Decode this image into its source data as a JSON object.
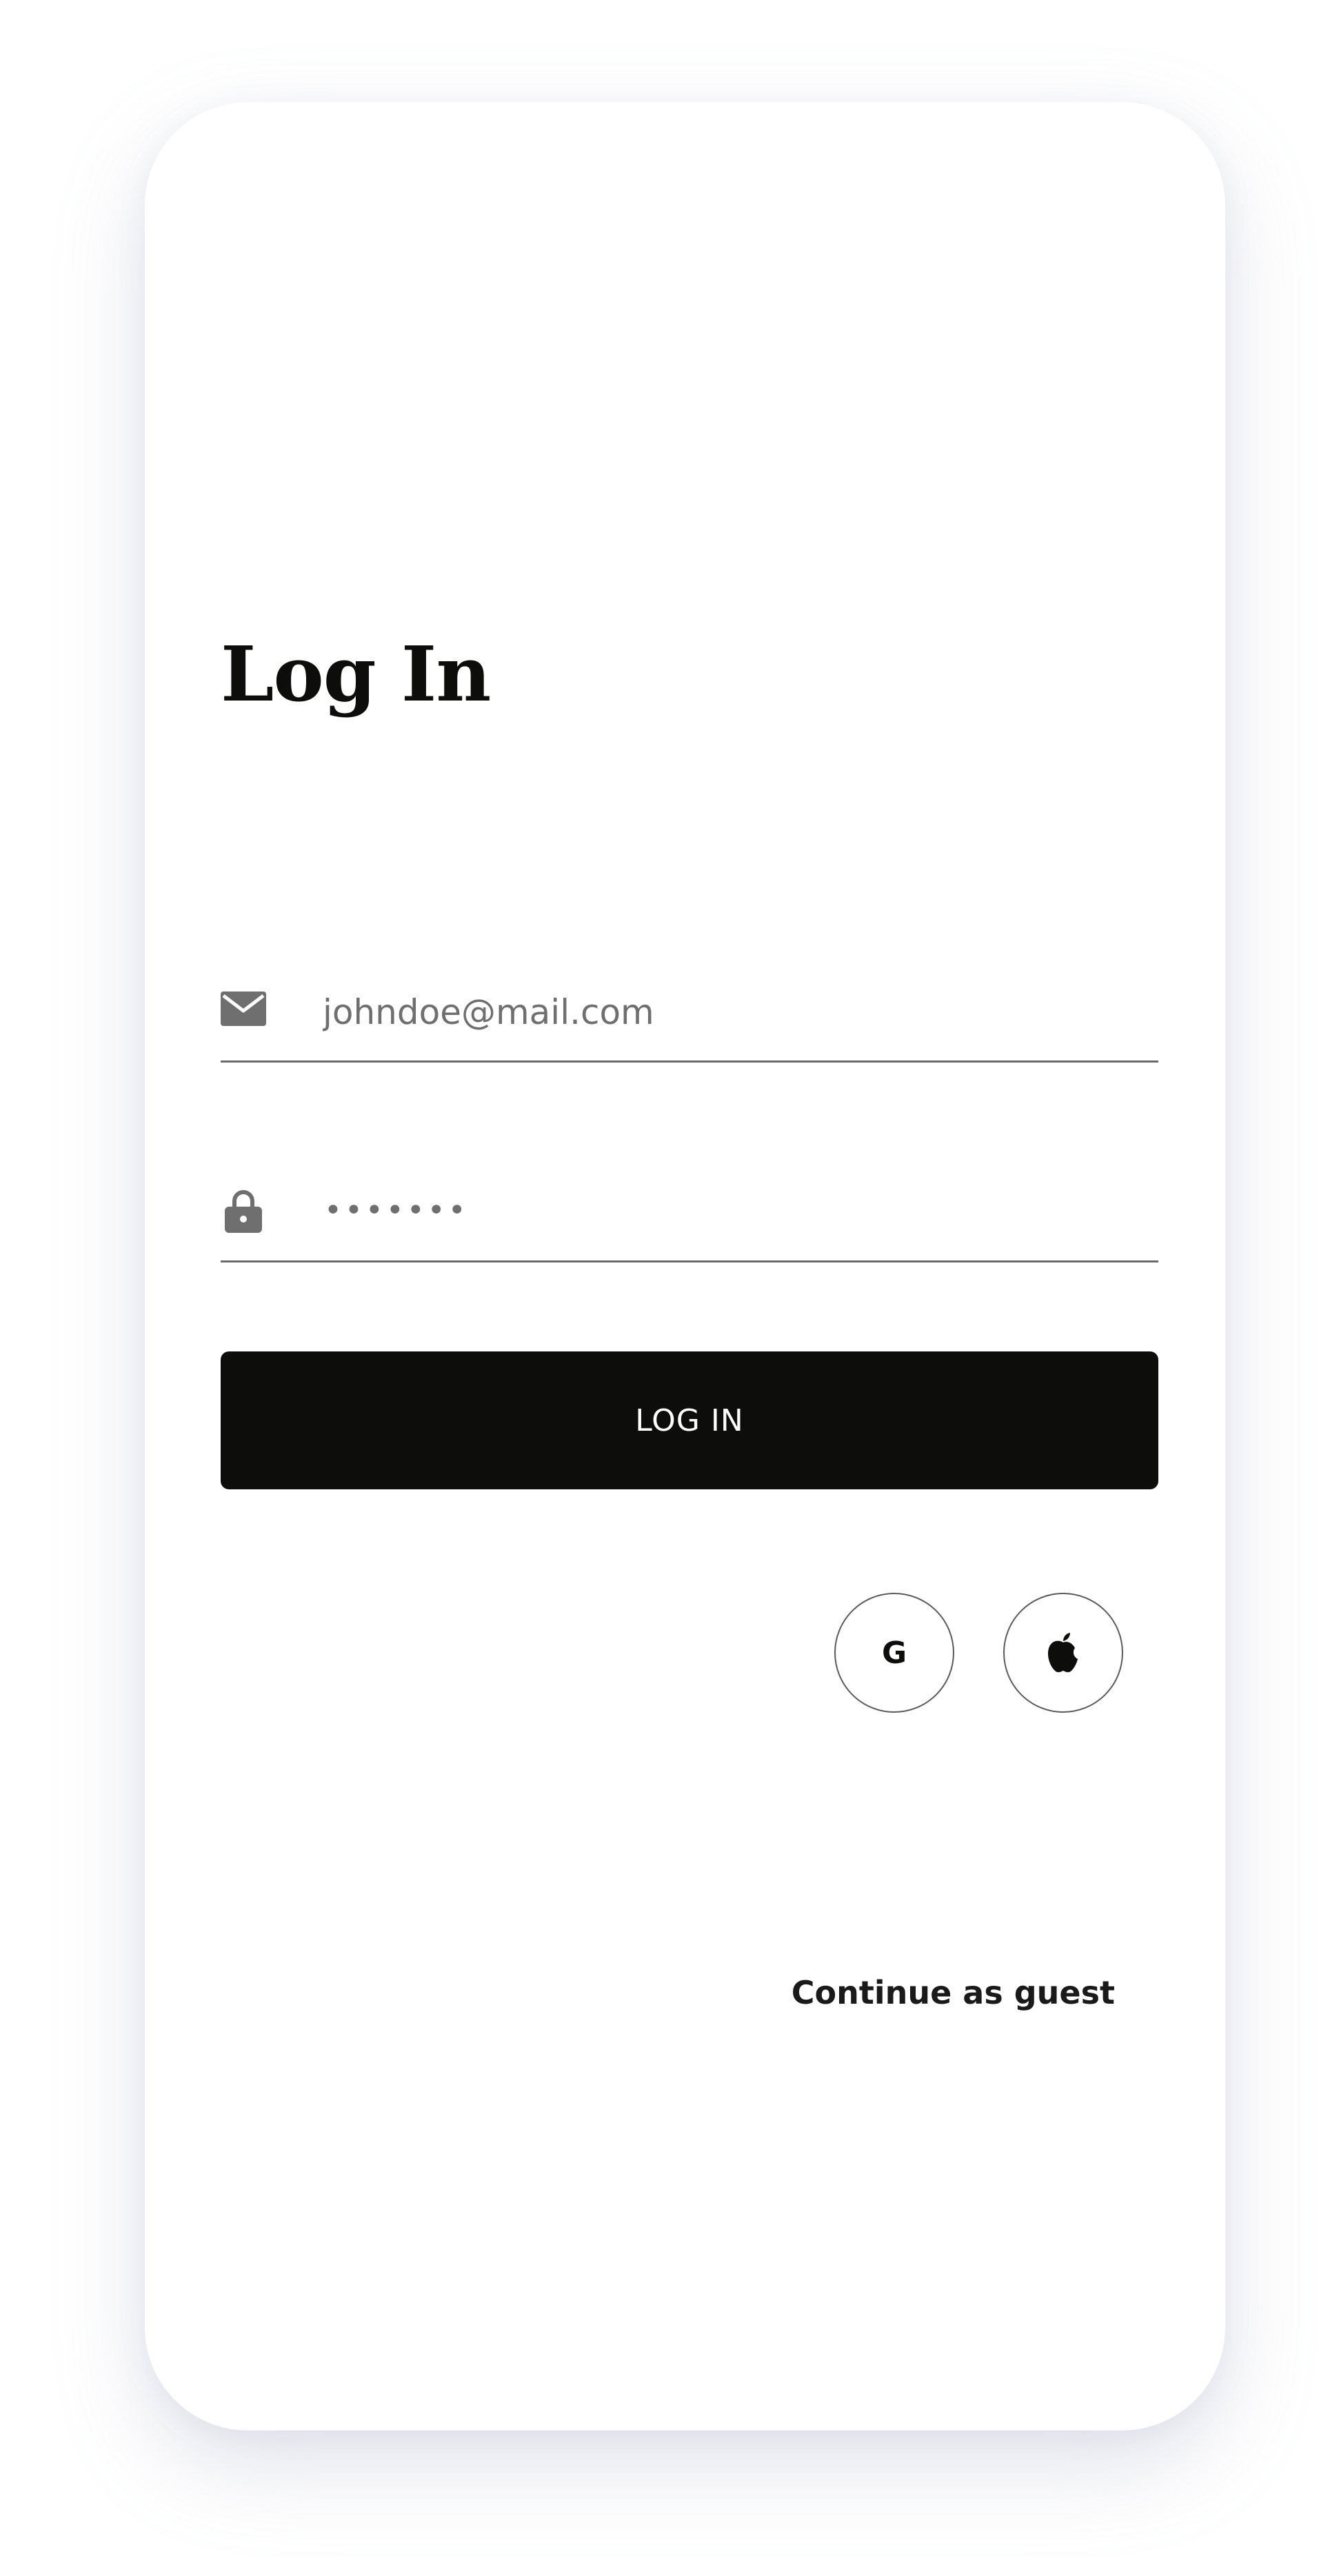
{
  "login": {
    "title": "Log In",
    "email": {
      "placeholder": "johndoe@mail.com",
      "icon": "envelope-icon"
    },
    "password": {
      "masked_value": "•••••••",
      "icon": "lock-icon"
    },
    "submit_label": "LOG IN",
    "social": [
      {
        "provider": "Google",
        "icon": "google-icon",
        "glyph": "G"
      },
      {
        "provider": "Apple",
        "icon": "apple-icon"
      }
    ],
    "guest_label": "Continue as guest"
  },
  "colors": {
    "background": "#ffffff",
    "button": "#0d0e0b",
    "button_text": "#ffffff",
    "icon": "#6f6f6f",
    "divider": "#6a6a6a",
    "title": "#0d0d0b"
  }
}
